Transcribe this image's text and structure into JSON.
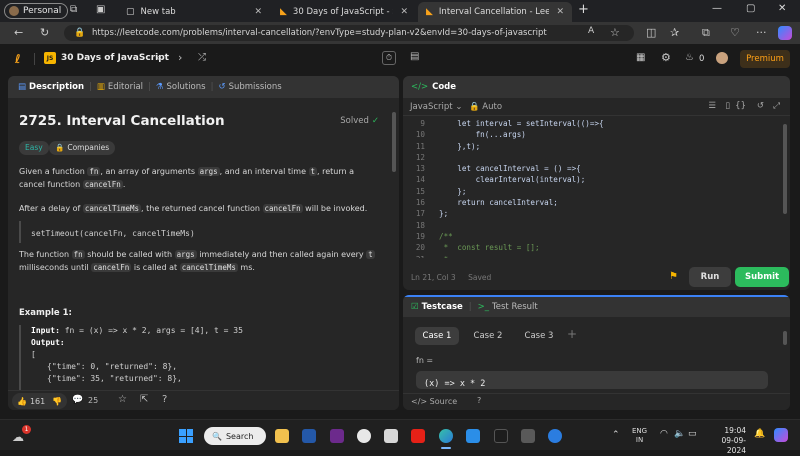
{
  "browser": {
    "profile_label": "Personal",
    "tabs": [
      {
        "label": "New tab",
        "active": false
      },
      {
        "label": "30 Days of JavaScript - Study Plan",
        "active": false
      },
      {
        "label": "Interval Cancellation - LeetCode",
        "active": true
      }
    ],
    "url": "https://leetcode.com/problems/interval-cancellation/?envType=study-plan-v2&envId=30-days-of-javascript"
  },
  "lc_nav": {
    "js_badge": "JS",
    "study_plan_title": "30 Days of JavaScript",
    "streak_count": "0",
    "premium_label": "Premium"
  },
  "left_tabs": {
    "description": "Description",
    "editorial": "Editorial",
    "solutions": "Solutions",
    "submissions": "Submissions"
  },
  "problem": {
    "title": "2725. Interval Cancellation",
    "status": "Solved",
    "difficulty": "Easy",
    "companies_label": "Companies",
    "p1": [
      "Given a function ",
      "fn",
      ", an array of arguments ",
      "args",
      ", and an interval time ",
      "t",
      ", return a cancel function ",
      "cancelFn",
      "."
    ],
    "p2": [
      "After a delay of ",
      "cancelTimeMs",
      ", the returned cancel function ",
      "cancelFn",
      " will be invoked."
    ],
    "code_block": "setTimeout(cancelFn, cancelTimeMs)",
    "p3": [
      "The function ",
      "fn",
      " should be called with ",
      "args",
      " immediately and then called again every ",
      "t",
      " milliseconds until ",
      "cancelFn",
      " is called at ",
      "cancelTimeMs",
      " ms."
    ],
    "example_title": "Example 1:",
    "input_label": "Input:",
    "input_value": "fn = (x) => x * 2, args = [4], t = 35",
    "output_label": "Output:",
    "output_lines": [
      "[",
      "{\"time\": 0, \"returned\": 8},",
      "{\"time\": 35, \"returned\": 8},"
    ]
  },
  "footer_left": {
    "likes": "161",
    "comments": "25"
  },
  "code_panel": {
    "title": "Code",
    "language": "JavaScript",
    "mode": "Auto",
    "lines": [
      {
        "n": "9",
        "text": "    let interval = setInterval(()=>{"
      },
      {
        "n": "10",
        "text": "        fn(...args)"
      },
      {
        "n": "11",
        "text": "    },t);"
      },
      {
        "n": "12",
        "text": ""
      },
      {
        "n": "13",
        "text": "    let cancelInterval = () =>{"
      },
      {
        "n": "14",
        "text": "        clearInterval(interval);"
      },
      {
        "n": "15",
        "text": "    };"
      },
      {
        "n": "16",
        "text": "    return cancelInterval;"
      },
      {
        "n": "17",
        "text": "};"
      },
      {
        "n": "18",
        "text": ""
      },
      {
        "n": "19",
        "text": "/**"
      },
      {
        "n": "20",
        "text": " *  const result = [];"
      },
      {
        "n": "21",
        "text": " *"
      }
    ],
    "cursor_pos": "Ln 21, Col 3",
    "save_state": "Saved",
    "run_label": "Run",
    "submit_label": "Submit"
  },
  "test_panel": {
    "testcase_tab": "Testcase",
    "result_tab": "Test Result",
    "cases": [
      "Case 1",
      "Case 2",
      "Case 3"
    ],
    "add_case": "+",
    "param_label": "fn =",
    "param_value": "(x) => x * 2",
    "source_label": "Source"
  },
  "taskbar": {
    "search_label": "Search",
    "lang_top": "ENG",
    "lang_bottom": "IN",
    "time": "19:04",
    "date": "09-09-2024",
    "weather_badge": "1"
  },
  "colors": {
    "accent_green": "#2cbb5d",
    "easy_teal": "#2db7a8",
    "premium_orange": "#ffa116",
    "code_blue": "#5b9bff"
  }
}
